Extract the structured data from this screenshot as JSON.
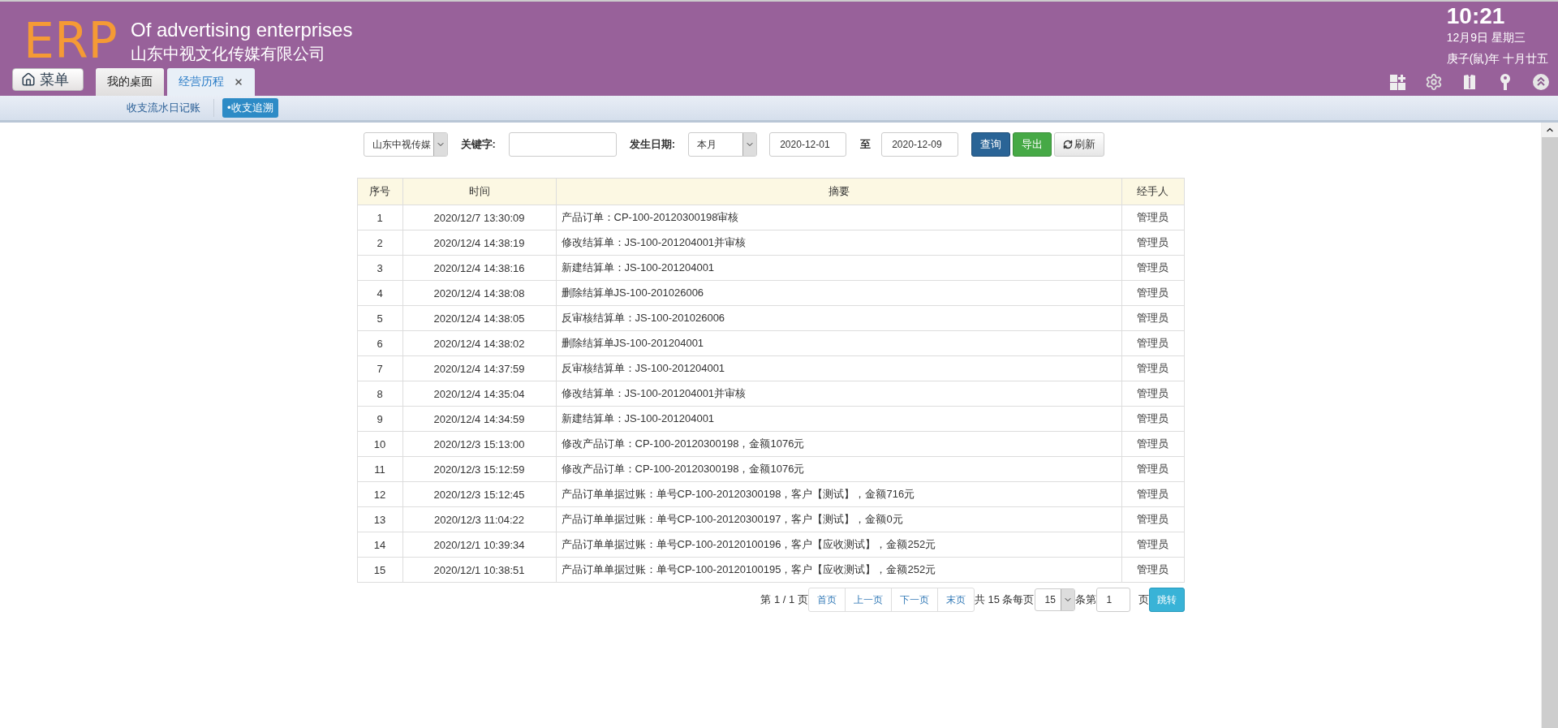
{
  "header": {
    "logo": "ERP",
    "subtitle": "Of advertising enterprises",
    "company": "山东中视文化传媒有限公司",
    "menu_button": "菜单",
    "clock": {
      "time": "10:21",
      "date": "12月9日 星期三",
      "lunar": "庚子(鼠)年 十月廿五"
    }
  },
  "tabs": [
    {
      "label": "我的桌面",
      "selected": false,
      "closable": false
    },
    {
      "label": "经营历程",
      "selected": true,
      "closable": true
    }
  ],
  "subnav": [
    {
      "label": "收支流水日记账",
      "selected": false
    },
    {
      "label": "•收支追溯",
      "selected": true
    }
  ],
  "filters": {
    "company": "山东中视传媒",
    "keyword_label": "关键字:",
    "date_label": "发生日期:",
    "period": "本月",
    "start_date": "2020-12-01",
    "separator": "至",
    "end_date": "2020-12-09",
    "buttons": [
      {
        "label": "查询",
        "kind": "primary"
      },
      {
        "label": "导出",
        "kind": "success"
      },
      {
        "label": "刷新",
        "kind": "refresh"
      }
    ]
  },
  "table": {
    "columns": [
      "序号",
      "时间",
      "摘要",
      "经手人"
    ],
    "rows": [
      [
        "1",
        "2020/12/7 13:30:09",
        "产品订单：CP-100-20120300198审核",
        "管理员"
      ],
      [
        "2",
        "2020/12/4 14:38:19",
        "修改结算单：JS-100-201204001并审核",
        "管理员"
      ],
      [
        "3",
        "2020/12/4 14:38:16",
        "新建结算单：JS-100-201204001",
        "管理员"
      ],
      [
        "4",
        "2020/12/4 14:38:08",
        "删除结算单JS-100-201026006",
        "管理员"
      ],
      [
        "5",
        "2020/12/4 14:38:05",
        "反审核结算单：JS-100-201026006",
        "管理员"
      ],
      [
        "6",
        "2020/12/4 14:38:02",
        "删除结算单JS-100-201204001",
        "管理员"
      ],
      [
        "7",
        "2020/12/4 14:37:59",
        "反审核结算单：JS-100-201204001",
        "管理员"
      ],
      [
        "8",
        "2020/12/4 14:35:04",
        "修改结算单：JS-100-201204001并审核",
        "管理员"
      ],
      [
        "9",
        "2020/12/4 14:34:59",
        "新建结算单：JS-100-201204001",
        "管理员"
      ],
      [
        "10",
        "2020/12/3 15:13:00",
        "修改产品订单：CP-100-20120300198，金额1076元",
        "管理员"
      ],
      [
        "11",
        "2020/12/3 15:12:59",
        "修改产品订单：CP-100-20120300198，金额1076元",
        "管理员"
      ],
      [
        "12",
        "2020/12/3 15:12:45",
        "产品订单单据过账：单号CP-100-20120300198，客户【测试】，金额716元",
        "管理员"
      ],
      [
        "13",
        "2020/12/3 11:04:22",
        "产品订单单据过账：单号CP-100-20120300197，客户【测试】，金额0元",
        "管理员"
      ],
      [
        "14",
        "2020/12/1 10:39:34",
        "产品订单单据过账：单号CP-100-20120100196，客户【应收测试】，金额252元",
        "管理员"
      ],
      [
        "15",
        "2020/12/1 10:38:51",
        "产品订单单据过账：单号CP-100-20120100195，客户【应收测试】，金额252元",
        "管理员"
      ]
    ]
  },
  "pagination": {
    "page_info": "第 1 / 1 页",
    "links": [
      "首页",
      "上一页",
      "下一页",
      "末页"
    ],
    "total": "共 15 条每页",
    "page_size": "15",
    "per_label": "条第",
    "page_input": "1",
    "page_suffix": "页",
    "go": "跳转"
  }
}
